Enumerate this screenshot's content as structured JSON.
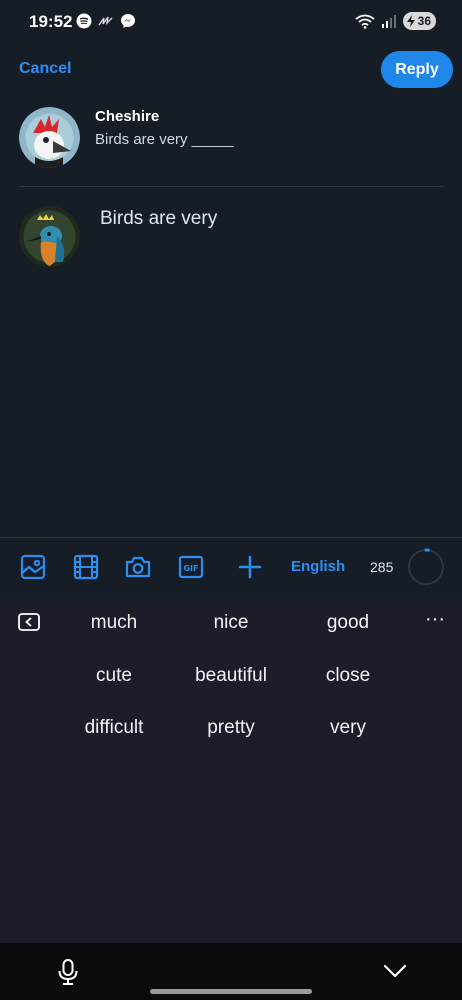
{
  "status_bar": {
    "time": "19:52",
    "left_icons": [
      "spotify-icon",
      "scribble-icon",
      "messenger-icon"
    ],
    "right_icons": [
      "wifi-icon",
      "signal-icon"
    ],
    "battery_level": "36"
  },
  "header": {
    "cancel_label": "Cancel",
    "reply_label": "Reply"
  },
  "parent_post": {
    "author": "Cheshire",
    "text": "Birds are very _____"
  },
  "composer": {
    "text": "Birds are very"
  },
  "toolbar": {
    "icons": [
      "image-icon",
      "video-icon",
      "camera-icon",
      "gif-icon",
      "add-icon"
    ],
    "language": "English",
    "remaining_chars": "285",
    "progress_fraction": 0.02
  },
  "keyboard": {
    "suggestions": [
      [
        "much",
        "nice",
        "good"
      ],
      [
        "cute",
        "beautiful",
        "close"
      ],
      [
        "difficult",
        "pretty",
        "very"
      ]
    ]
  },
  "colors": {
    "background": "#161d27",
    "accent": "#1f86ea",
    "keyboard_bg": "#1c1d2b"
  }
}
